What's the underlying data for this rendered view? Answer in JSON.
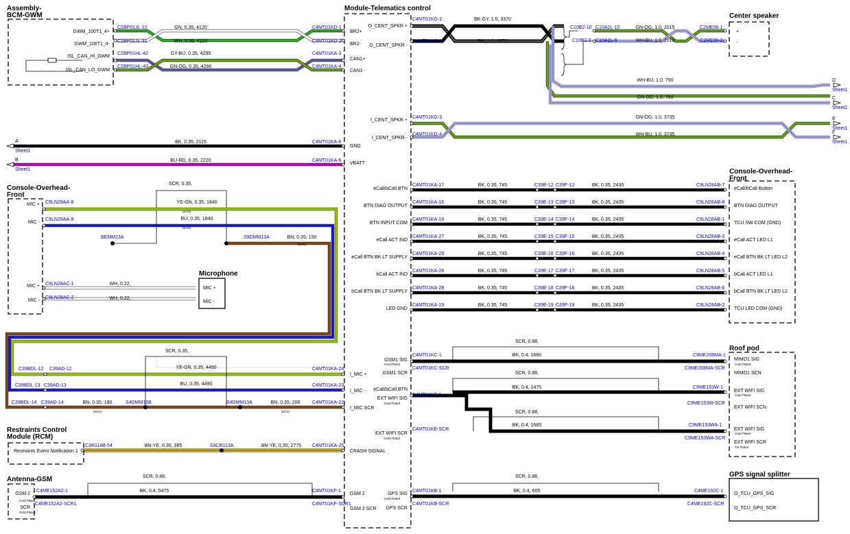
{
  "components": [
    {
      "id": "bcm",
      "title": [
        "Assembly-",
        "BCM-GWM"
      ]
    },
    {
      "id": "tcu",
      "title": [
        "Module-Telematics control"
      ]
    },
    {
      "id": "spk",
      "title": [
        "Center speaker"
      ]
    },
    {
      "id": "ovh1",
      "title": [
        "Console-Overhead-",
        "Front"
      ]
    },
    {
      "id": "ovh2",
      "title": [
        "Console-Overhead-",
        "Front"
      ]
    },
    {
      "id": "mic",
      "title": [
        "Microphone"
      ]
    },
    {
      "id": "rcm",
      "title": [
        "Restraints Control",
        "Module (RCM)"
      ]
    },
    {
      "id": "ant",
      "title": [
        "Antenna-GSM"
      ]
    },
    {
      "id": "roof",
      "title": [
        "Roof pod"
      ]
    },
    {
      "id": "gps",
      "title": [
        "GPS signal splitter"
      ]
    }
  ],
  "pins": [
    {
      "t": "GWM_100T1_4+",
      "a": "end"
    },
    {
      "t": "GWM_100T1_4-",
      "a": "end"
    },
    {
      "t": "ISL_CAN_HI_GWM",
      "a": "end"
    },
    {
      "t": "ISL_CAN_LO_GWM",
      "a": "end"
    },
    {
      "t": "BR2+"
    },
    {
      "t": "BR2-"
    },
    {
      "t": "CAN1+"
    },
    {
      "t": "CAN1-"
    },
    {
      "t": "GND"
    },
    {
      "t": "VBATT"
    },
    {
      "t": "I_MIC +"
    },
    {
      "t": "I_MIC -"
    },
    {
      "t": "I_MIC SCR"
    },
    {
      "t": "CRASH SIGNAL"
    },
    {
      "t": "GSM 2"
    },
    {
      "t": "GSM 2 SCR"
    },
    {
      "t": "O_CENT_SPKR +",
      "a": "end"
    },
    {
      "t": "O_CENT_SPKR -",
      "a": "end"
    },
    {
      "t": "I_CENT_SPKR +",
      "a": "end"
    },
    {
      "t": "I_CENT_SPKR -",
      "a": "end"
    },
    {
      "t": "eCall/bCall BTN",
      "a": "end"
    },
    {
      "t": "BTN DIAG OUTPUT",
      "a": "end"
    },
    {
      "t": "BTN INPUT COM",
      "a": "end"
    },
    {
      "t": "eCall ACT IND",
      "a": "end"
    },
    {
      "t": "eCall BTN BK LT SUPPLY",
      "a": "end"
    },
    {
      "t": "bCall ACT IND",
      "a": "end"
    },
    {
      "t": "bCall BTN BK LT SUPPLY",
      "a": "end"
    },
    {
      "t": "LED GND",
      "a": "end"
    },
    {
      "t": "GSM1 SIG",
      "a": "end"
    },
    {
      "t": "GSM1 SCR",
      "a": "end"
    },
    {
      "t": "EXT WIFI SIG",
      "a": "end"
    },
    {
      "t": "EXT WIFI SCR",
      "a": "end"
    },
    {
      "t": "GPS SIG",
      "a": "end"
    },
    {
      "t": "GPS SCR",
      "a": "end"
    },
    {
      "t": "+"
    },
    {
      "t": "-"
    },
    {
      "t": "eCall/bCall Button"
    },
    {
      "t": "BTN DIAG OUTPUT"
    },
    {
      "t": "TCU SW COM (GND)"
    },
    {
      "t": "eCall ACT LED L1"
    },
    {
      "t": "eCall BTN BK LT LED L2"
    },
    {
      "t": "bCall ACT LED L1"
    },
    {
      "t": "bCall BTN BK LT LED L2"
    },
    {
      "t": "TCU LED COM (GND)"
    },
    {
      "t": "MIMO1 SIG"
    },
    {
      "t": "MIMO1 SCN"
    },
    {
      "t": "EXT WIFI SIG"
    },
    {
      "t": "EXT WIFI SCN"
    },
    {
      "t": "EXT WIFI SIG"
    },
    {
      "t": "EXT WIFI SCR"
    },
    {
      "t": "O_TCU_GPS_SIG"
    },
    {
      "t": "O_TCU_GPS_SCR"
    },
    {
      "t": "MIC +",
      "a": "end"
    },
    {
      "t": "MIC -",
      "a": "end"
    },
    {
      "t": "MIC +",
      "a": "end"
    },
    {
      "t": "MIC -",
      "a": "end"
    },
    {
      "t": "MIC +"
    },
    {
      "t": "MIC -"
    },
    {
      "t": "Restraints Event Notification 1"
    },
    {
      "t": "GSM 2",
      "a": "end"
    },
    {
      "t": "SCR",
      "a": "end"
    }
  ],
  "plating": [
    "Gold Plated",
    "Gold Plated",
    "Gold Plated",
    "Gold Plated",
    "Gold Plated",
    "Gold Plated",
    "Gold Plated",
    "Gold Plated",
    "Gold Plated",
    "Gold Plated",
    "Gold Plated",
    "Tin Plated",
    "Gold Plated"
  ],
  "connectors": [
    "C2BP01JL-32",
    "C2BP01JL-31",
    "C2BP01HL-42",
    "C2BP01HL-43",
    "C4MT01KD-1",
    "C4MT01KD-2",
    "C4MT01KA-3",
    "C4MT01KA-4",
    "C4MT01KA-8",
    "C4MT01KA-6",
    "C4MT01KG-2",
    "C4MT01KG-1",
    "C10B2-10",
    "C10A2L-10",
    "C10B2-9",
    "C10A2L-9",
    "C2ME06-1",
    "C2ME06-2",
    "C4MT01KG-3",
    "C4MT01KG-4",
    "C4MT01KA-17",
    "C4MT01KA-16",
    "C4MT01KA-18",
    "C4MT01KA-27",
    "C4MT01KA-29",
    "C4MT01KA-26",
    "C4MT01KA-28",
    "C4MT01KA-19",
    "C39E-12",
    "C39E-13",
    "C39E-14",
    "C39E-15",
    "C39E-16",
    "C39E-17",
    "C39E-18",
    "C39E-19",
    "C39F-12",
    "C39F-13",
    "C39F-14",
    "C39F-15",
    "C39F-16",
    "C39F-17",
    "C39F-18",
    "C39F-19",
    "C9LN28AB-7",
    "C9LN28AB-8",
    "C9LN28AB-1",
    "C9LN28AB-3",
    "C9LN28AB-4",
    "C9LN28AB-5",
    "C9LN28AB-6",
    "C9LN28AB-2",
    "C9LN28AA-8",
    "C9LN28AA-9",
    "C9LN28AC-1",
    "C9LN28AC-2",
    "C39BDL-12",
    "C39AD-12",
    "C39BDL-13",
    "C39AD-13",
    "C39BDL-14",
    "C39AD-14",
    "C4MT01KA-24",
    "C4MT01KA-23",
    "C4MT01KA-22",
    "C3R114B-54",
    "C4MT01KA-25",
    "C4ME152A2-1",
    "C4ME152A2-SCR1",
    "C4MT01KF-1",
    "C4MT01KF-SCR1",
    "C4MT01KC-1",
    "C4MT01KC-SCR",
    "C9ME208MA-1",
    "C9ME208MA-SCR",
    "C4MT01KE-1",
    "C4MT01KE-SCR",
    "C9ME153W-1",
    "C9ME153W-SCR",
    "C9ME153WA-1",
    "C9ME153WA-SCR",
    "C4MT01KB-1",
    "C4MT01KB-SCR",
    "C4ME192C-1",
    "C4ME192C-SCR"
  ],
  "wires": [
    "GN,  0.35,  4120",
    "WH,  0.35,  4120",
    "GY-BU,  0.35,  4295",
    "GN-OG,  0.35,  4290",
    "BK,  0.35,  2115",
    "BU-RD,  0.35,  2220",
    "BK-GY,  1.0,  3370",
    "BK,  1.0,  3370",
    "GN-OG,  1.0,  2015",
    "WH-BU,  1.0,  2015",
    "WH-BU,  1.0,  750",
    "GN-OG,  1.0,  750",
    "GN-OG,  1.0,  3735",
    "WH-BU,  1.0,  3735",
    "BK,  0.35,  745",
    "BK,  0.35,  2435",
    "BK,  0.35,  745",
    "BK,  0.35,  2435",
    "BK,  0.35,  745",
    "BK,  0.35,  2435",
    "BK,  0.35,  745",
    "BK,  0.35,  2435",
    "BK,  0.35,  745",
    "BK,  0.35,  2435",
    "BK,  0.35,  745",
    "BK,  0.35,  2435",
    "BK,  0.35,  745",
    "BK,  0.35,  2435",
    "BK,  0.35,  745",
    "BK,  0.35,  2435",
    "SCR,  0.35,",
    "YE-GN,  0.35,  1840",
    "BU,  0.35,  1840",
    "BN,  0.35,  150",
    "WH,  0.22,",
    "WH,  0.22,",
    "SCR,  0.35,",
    "YE-GN,  0.35,  4490",
    "BU,  0.35,  4490",
    "BN,  0.35,  180",
    "BN,  0.35,  200",
    "BN-YE,  0.35,  385",
    "BN-YE,  0.35,  2775",
    "SCR,  0.88,",
    "BK,  0.4,  5475",
    "SCR,  0.88,",
    "BK,  0.4,  1660",
    "SCR,  0.88,",
    "BK,  0.4,  1475",
    "SCR,  0.88,",
    "BK,  0.4,  1685",
    "SCR,  0.88,",
    "BK,  0.4,  605"
  ],
  "splices": [
    "BEMM23A",
    "S9DMM13A",
    "S4DMM13B",
    "S4DMM13A",
    "S3CR113A"
  ],
  "sos": [
    "(SOS)",
    "(SOS)",
    "(SOS)",
    "(SOS)",
    "(SOS)",
    "(SOS)",
    "(SOS)"
  ],
  "offpage": [
    {
      "letter": "A",
      "sheet": "Sheet1"
    },
    {
      "letter": "B",
      "sheet": "Sheet1"
    },
    {
      "letter": "D",
      "sheet": "Sheet1"
    },
    {
      "letter": "C",
      "sheet": "Sheet1"
    },
    {
      "letter": "E",
      "sheet": "Sheet1"
    },
    {
      "letter": "F",
      "sheet": "Sheet1"
    }
  ],
  "colors": {
    "GN": "#22b014",
    "WH": "#ffffff",
    "GY": "#8a8a8a",
    "BU": "#1515e0",
    "OG": "#e08000",
    "BK": "#000000",
    "RD": "#d00000",
    "YE": "#f2e800",
    "BN": "#8b4513",
    "connector_text": "#0000c8",
    "magenta": "#c000c0",
    "olive": "#7a9a10"
  }
}
